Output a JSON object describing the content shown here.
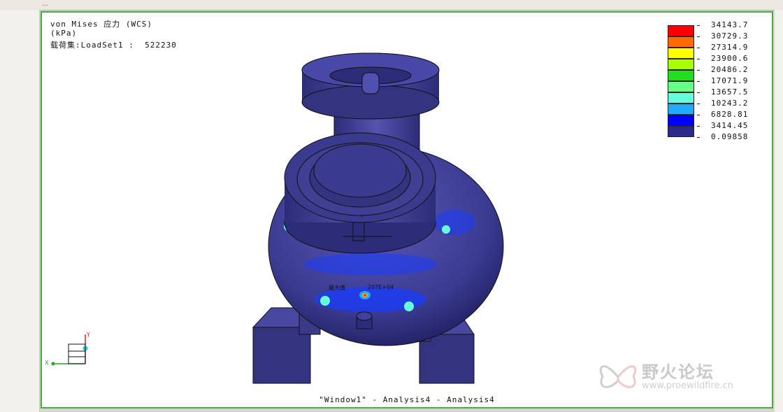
{
  "window": {
    "title_fragment": "...",
    "caption": "\"Window1\" - Analysis4 - Analysis4"
  },
  "result": {
    "line1": "von Mises 应力 (WCS)",
    "line2": "(kPa)",
    "line3_label": "载荷集:LoadSet1 :",
    "line3_value": "522230"
  },
  "legend": {
    "values": [
      "34143.7",
      "30729.3",
      "27314.9",
      "23900.6",
      "20486.2",
      "17071.9",
      "13657.5",
      "10243.2",
      "6828.81",
      "3414.45",
      "0.09858"
    ],
    "colors": [
      "#ff0000",
      "#ff6a00",
      "#ffff00",
      "#a8ff00",
      "#22dd22",
      "#66ff88",
      "#66ffdd",
      "#22aaff",
      "#0000ff",
      "#2a2a8a"
    ]
  },
  "model": {
    "tag_label": "最大值",
    "tag_value": "207E+04",
    "base_color": "#3e3e8e"
  },
  "triad": {
    "axis_y": "Y",
    "axis_x": "X"
  },
  "watermark": {
    "title": "野火论坛",
    "url": "www.proewildfire.cn"
  }
}
